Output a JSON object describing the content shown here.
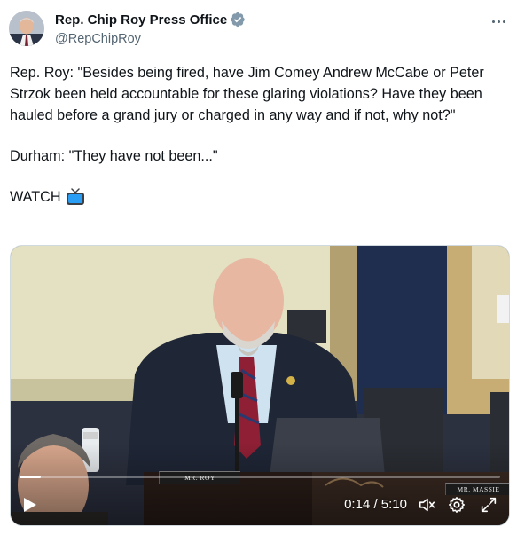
{
  "author": {
    "display_name": "Rep. Chip Roy Press Office",
    "handle": "@RepChipRoy",
    "verified": true,
    "verified_color": "#829aab"
  },
  "tweet": {
    "paragraphs": [
      "Rep. Roy: \"Besides being fired, have Jim Comey Andrew McCabe or Peter Strzok been held accountable for these glaring violations? Have they been hauled before a grand jury or charged in any way and if not, why not?\"",
      "Durham: \"They have not been...\"",
      "WATCH"
    ],
    "emoji": "television-icon"
  },
  "video": {
    "current_time": "0:14",
    "duration": "5:10",
    "time_display": "0:14 / 5:10",
    "progress": 0.045,
    "nameplates": {
      "roy": "MR. ROY",
      "massie": "MR. MASSIE"
    },
    "controls": [
      "play-icon",
      "mute-icon",
      "settings-icon",
      "fullscreen-icon"
    ]
  },
  "colors": {
    "text_primary": "#0f1419",
    "text_secondary": "#536471",
    "accent": "#1d9bf0"
  }
}
